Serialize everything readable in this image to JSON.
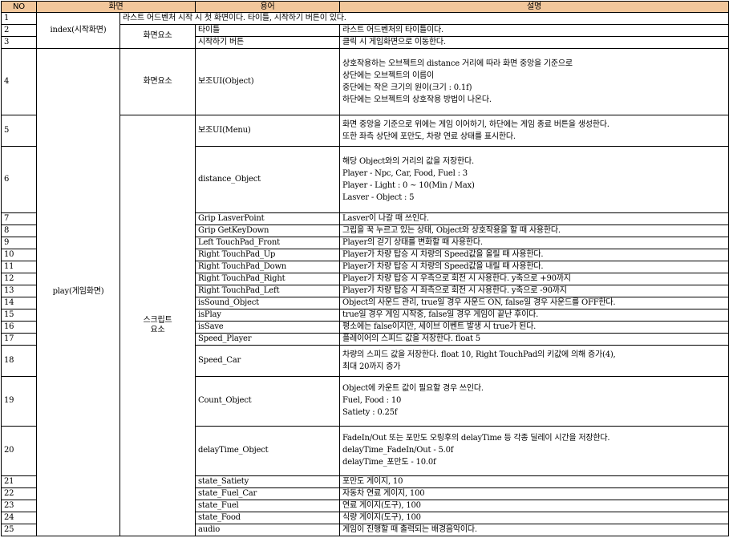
{
  "headers": [
    "NO",
    "화면",
    "용어",
    "설명"
  ],
  "groups": {
    "index_screen": "index(시작화면)",
    "play_screen": "play(게임화면)",
    "screen_elements": "화면요소",
    "script_elements": "스크립트\n요소"
  },
  "rows": [
    {
      "no": "1",
      "desc": "라스트 어드벤처 시작 시 첫 화면이다. 타이틀, 시작하기 버튼이 있다."
    },
    {
      "no": "2",
      "term": "타이틀",
      "desc": "라스트 어드벤처의 타이틀이다."
    },
    {
      "no": "3",
      "term": "시작하기 버튼",
      "desc": "클릭 시 게임화면으로 이동한다."
    },
    {
      "no": "4",
      "term": "보조UI(Object)",
      "desc": [
        "상호작용하는 오브젝트의 distance 거리에 따라 화면 중앙을 기준으로",
        "상단에는 오브젝트의 이름이",
        "중단에는 작은 크기의 원이(크기 : 0.1f)",
        "하단에는 오브젝트의 상호작용 방법이 나온다."
      ]
    },
    {
      "no": "5",
      "term": "보조UI(Menu)",
      "desc": [
        "화면 중앙을 기준으로 위에는 게임 이어하기, 하단에는 게임 종료 버튼을 생성한다.",
        "또한 좌측 상단에 포만도, 차량 연료 상태를 표시한다."
      ]
    },
    {
      "no": "6",
      "term": "distance_Object",
      "desc": [
        "해당 Object와의 거리의 값을 저장한다.",
        "Player - Npc, Car, Food, Fuel : 3",
        "Player - Light : 0 ~ 10(Min / Max)",
        "Lasver - Object : 5"
      ]
    },
    {
      "no": "7",
      "term": "Grip LasverPoint",
      "desc": "Lasver이 나갈 때 쓰인다."
    },
    {
      "no": "8",
      "term": "Grip GetKeyDown",
      "desc": "그립을 꾹 누르고 있는 상태, Object와 상호작용을 할 때 사용한다."
    },
    {
      "no": "9",
      "term": "Left TouchPad_Front",
      "desc": "Player의 걷기 상태를 변화할 때 사용한다."
    },
    {
      "no": "10",
      "term": "Right TouchPad_Up",
      "desc": "Player가 차량 탑승 시 차량의 Speed값을 올릴 때 사용한다."
    },
    {
      "no": "11",
      "term": "Right TouchPad_Down",
      "desc": "Player가 차량 탑승 시 차량의 Speed값을 내릴 때 사용한다."
    },
    {
      "no": "12",
      "term": "Right TouchPad_Right",
      "desc": "Player가 차량 탑승 시 우측으로 회전 시 사용한다. y축으로 +90까지"
    },
    {
      "no": "13",
      "term": "Right TouchPad_Left",
      "desc": "Player가 차량 탑승 시 좌측으로 회전 시 사용한다. y축으로 -90까지"
    },
    {
      "no": "14",
      "term": "isSound_Object",
      "desc": "Object의 사운드 관리, true일 경우 사운드 ON, false일 경우 사운드를 OFF한다."
    },
    {
      "no": "15",
      "term": "isPlay",
      "desc": "true일 경우 게임 시작중, false일 경우 게임이 끝난 후이다."
    },
    {
      "no": "16",
      "term": "isSave",
      "desc": "평소에는 false이지만, 세이브 이벤트 발생 시 true가 된다."
    },
    {
      "no": "17",
      "term": "Speed_Player",
      "desc": "플레이어의 스피드 값을 저장한다. float 5"
    },
    {
      "no": "18",
      "term": "Speed_Car",
      "desc": [
        "차량의 스피드 값을 저장한다. float 10, Right TouchPad의 키값에 의해 증가(4),",
        "최대 20까지 증가"
      ]
    },
    {
      "no": "19",
      "term": "Count_Object",
      "desc": [
        "Object에 카운트 값이 필요할 경우 쓰인다.",
        "Fuel, Food : 10",
        "Satiety : 0.25f"
      ]
    },
    {
      "no": "20",
      "term": "delayTime_Object",
      "desc": [
        "FadeIn/Out 또는 포만도 오링후의 delayTime 등 각종 딜레이 시간을 저장한다.",
        "delayTime_FadeIn/Out - 5.0f",
        "delayTime_포만도 - 10.0f"
      ]
    },
    {
      "no": "21",
      "term": "state_Satiety",
      "desc": "포만도 게이지, 10"
    },
    {
      "no": "22",
      "term": "state_Fuel_Car",
      "desc": "자동차 연료 게이지, 100"
    },
    {
      "no": "23",
      "term": "state_Fuel",
      "desc": "연료 게이지(도구), 100"
    },
    {
      "no": "24",
      "term": "state_Food",
      "desc": "식량 게이지(도구), 100"
    },
    {
      "no": "25",
      "term": "audio",
      "desc": "게임이 진행할 때 출력되는 배경음악이다."
    }
  ]
}
